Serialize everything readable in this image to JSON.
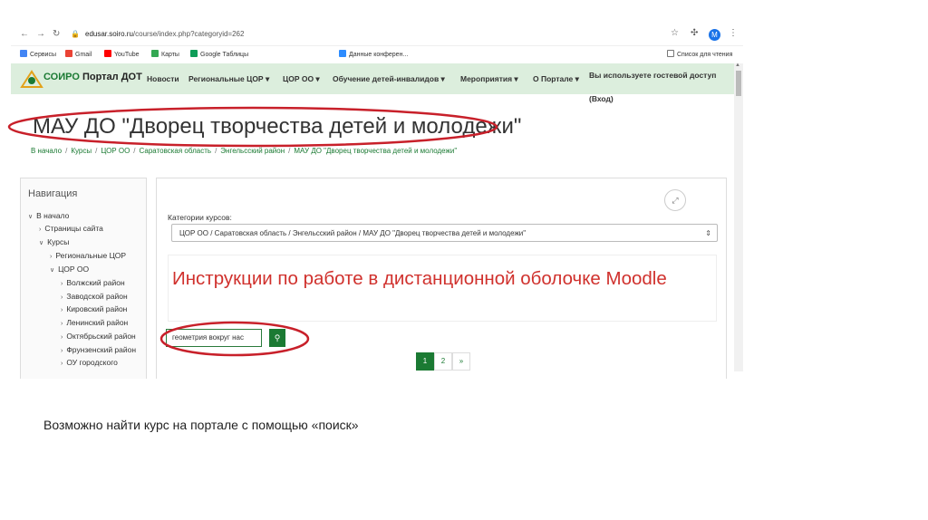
{
  "browser": {
    "url_host": "edusar.soiro.ru",
    "url_path": "/course/index.php?categoryid=262",
    "avatar_letter": "M",
    "bookmarks": [
      "Сервисы",
      "Gmail",
      "YouTube",
      "Карты",
      "Google Таблицы",
      "Данные конферен...",
      "Список для чтения"
    ]
  },
  "site": {
    "logo_text_1": "СОИРО",
    "logo_text_2": "Портал ДОТ",
    "menu": [
      "Новости",
      "Региональные ЦОР ▾",
      "ЦОР ОО ▾",
      "Обучение детей-инвалидов ▾",
      "Мероприятия ▾",
      "О Портале ▾"
    ],
    "guest_line1": "Вы используете гостевой доступ",
    "guest_line2": "(Вход)"
  },
  "page": {
    "title": "МАУ ДО \"Дворец творчества детей и молодежи\"",
    "breadcrumbs": [
      "В начало",
      "Курсы",
      "ЦОР ОО",
      "Саратовская область",
      "Энгельсский район",
      "МАУ ДО \"Дворец творчества детей и молодежи\""
    ]
  },
  "navigation": {
    "heading": "Навигация",
    "items": [
      "В начало",
      "Страницы сайта",
      "Курсы",
      "Региональные ЦОР",
      "ЦОР ОО",
      "Волжский район",
      "Заводской район",
      "Кировский район",
      "Ленинский район",
      "Октябрьский район",
      "Фрунзенский район",
      "ОУ городского"
    ]
  },
  "main": {
    "category_label": "Категории курсов:",
    "category_value": "ЦОР ОО / Саратовская область / Энгельсский район / МАУ ДО \"Дворец творчества детей и молодежи\"",
    "banner_text": "Инструкции по работе в дистанционной оболочке Moodle",
    "search_value": "геометрия вокруг нас",
    "pages": [
      "1",
      "2",
      "»"
    ]
  },
  "caption": "Возможно найти курс на портале с помощью «поиск»",
  "colors": {
    "accent": "#1b7a33",
    "highlight_ellipse": "#c8202a",
    "banner_text": "#d0312d",
    "header_bg": "#dceedd"
  }
}
